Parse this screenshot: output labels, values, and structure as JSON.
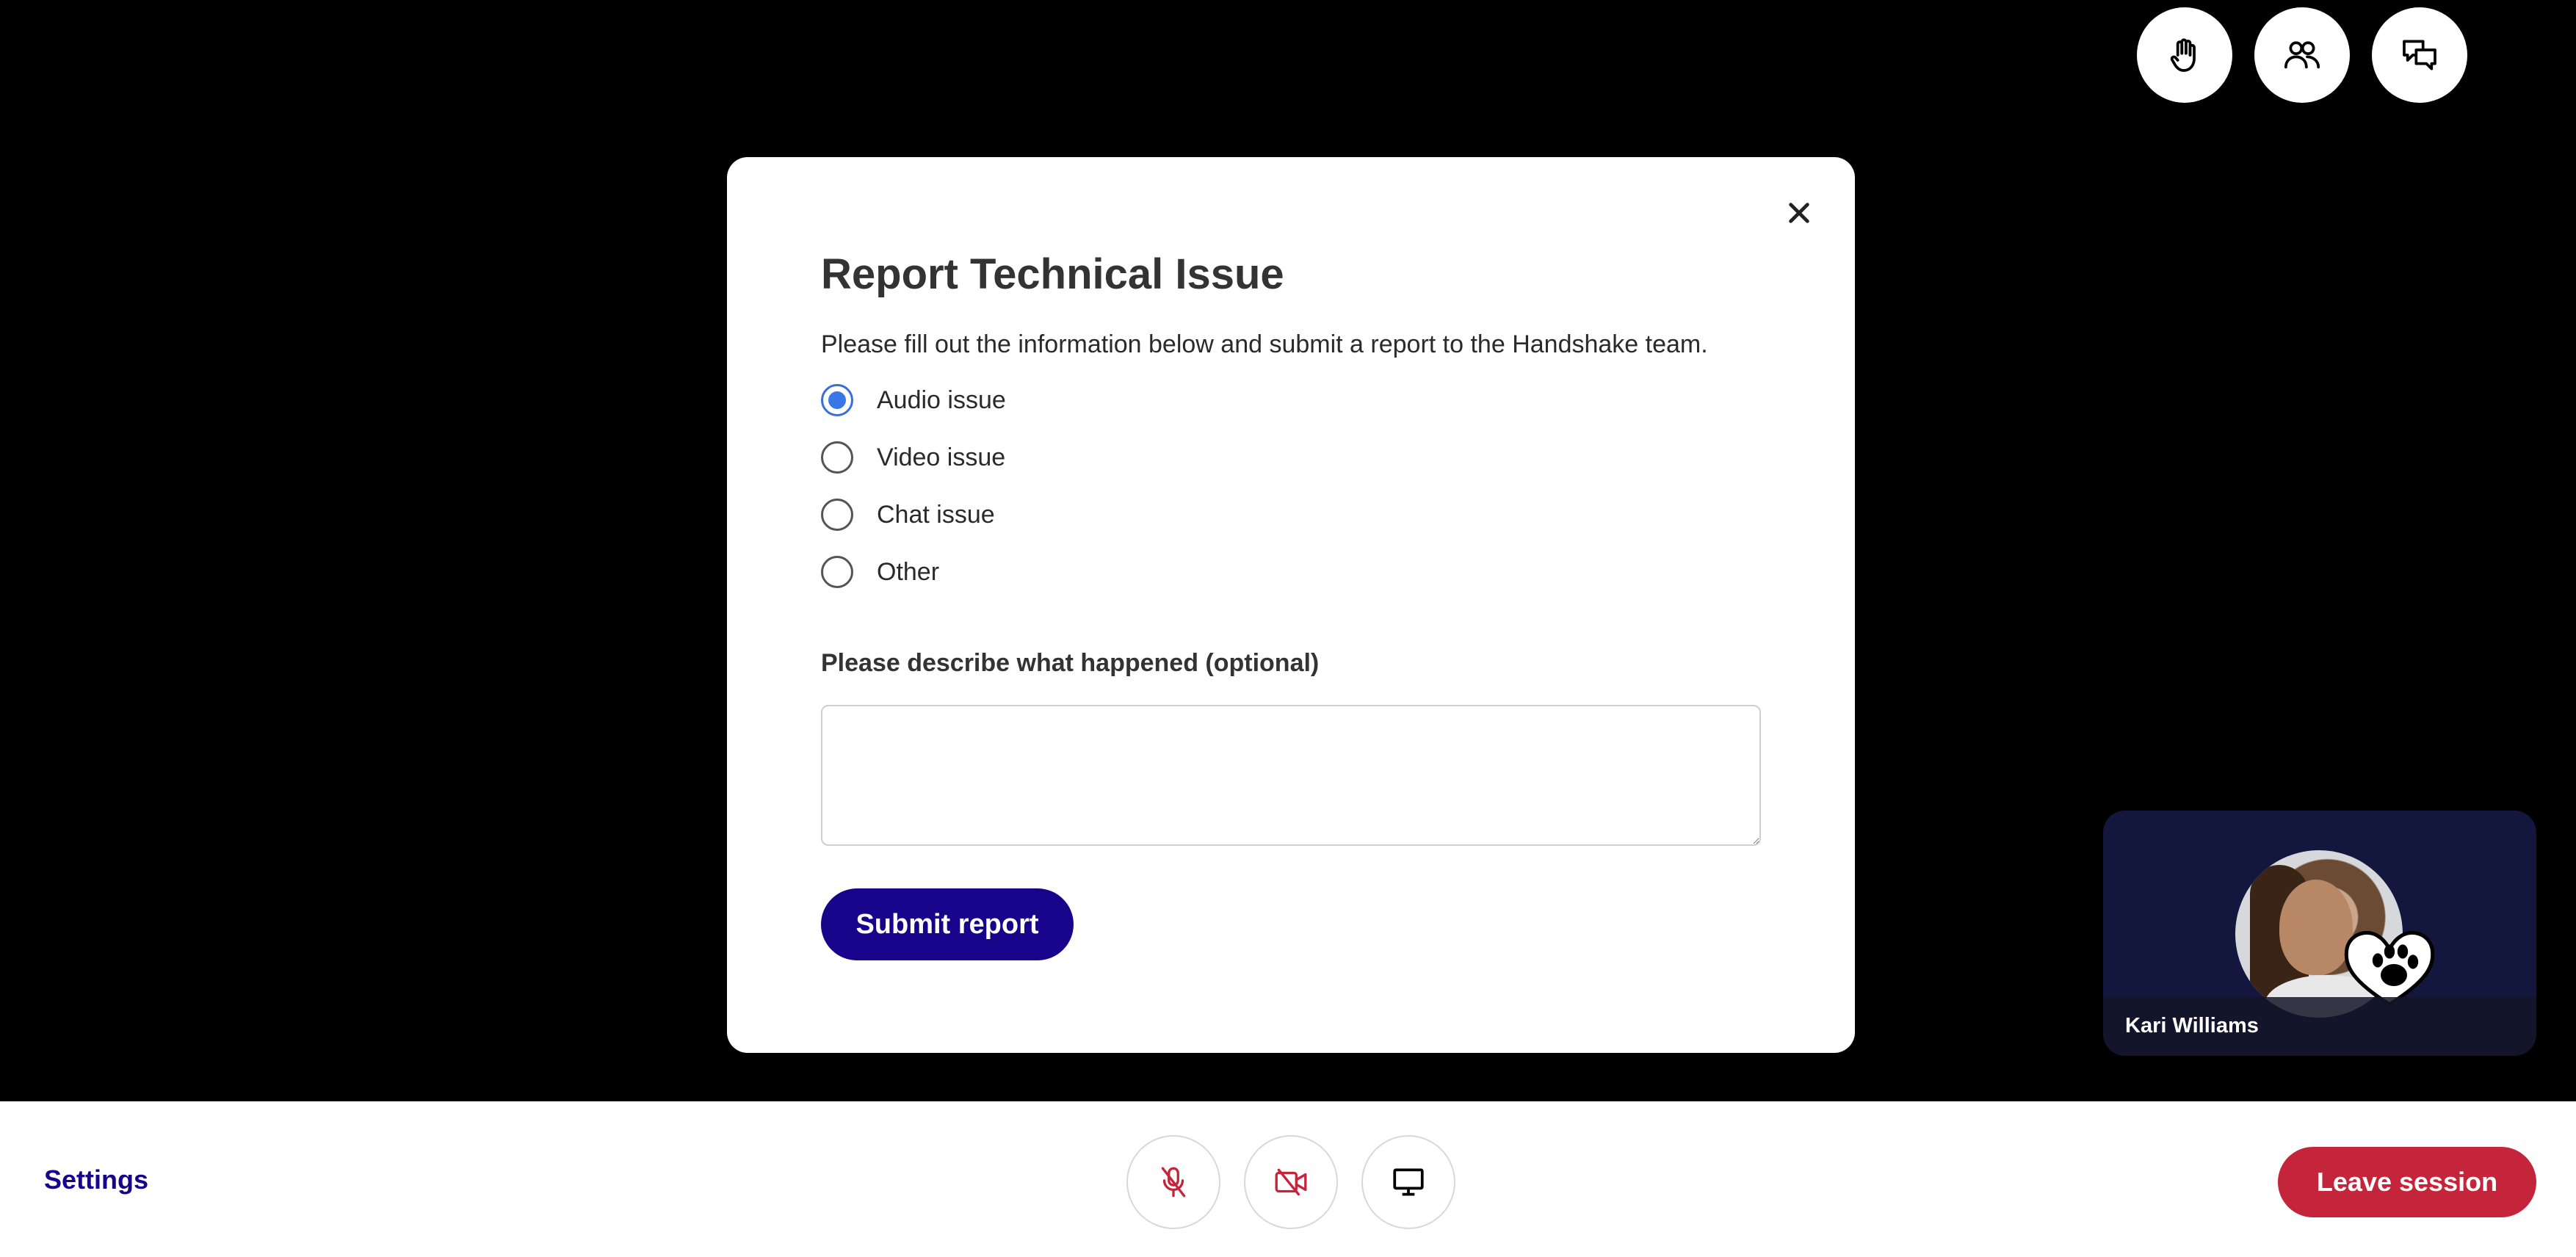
{
  "top_controls": {
    "raise_hand_icon": "hand-icon",
    "participants_icon": "participants-icon",
    "chat_icon": "chat-icon"
  },
  "modal": {
    "title": "Report Technical Issue",
    "description": "Please fill out the information below and submit a report to the Handshake team.",
    "options": [
      {
        "label": "Audio issue",
        "checked": true
      },
      {
        "label": "Video issue",
        "checked": false
      },
      {
        "label": "Chat issue",
        "checked": false
      },
      {
        "label": "Other",
        "checked": false
      }
    ],
    "details_label": "Please describe what happened (optional)",
    "details_value": "",
    "submit_label": "Submit report"
  },
  "participant": {
    "name": "Kari Williams",
    "badge_icon": "heart-paw-icon"
  },
  "bottombar": {
    "settings_label": "Settings",
    "mic_icon": "mic-off-icon",
    "camera_icon": "camera-off-icon",
    "screen_icon": "screen-share-icon",
    "leave_label": "Leave session"
  },
  "colors": {
    "brand": "#17048a",
    "danger": "#c4253b",
    "radio_checked": "#3b78e7",
    "tile_bg": "#13173e"
  }
}
